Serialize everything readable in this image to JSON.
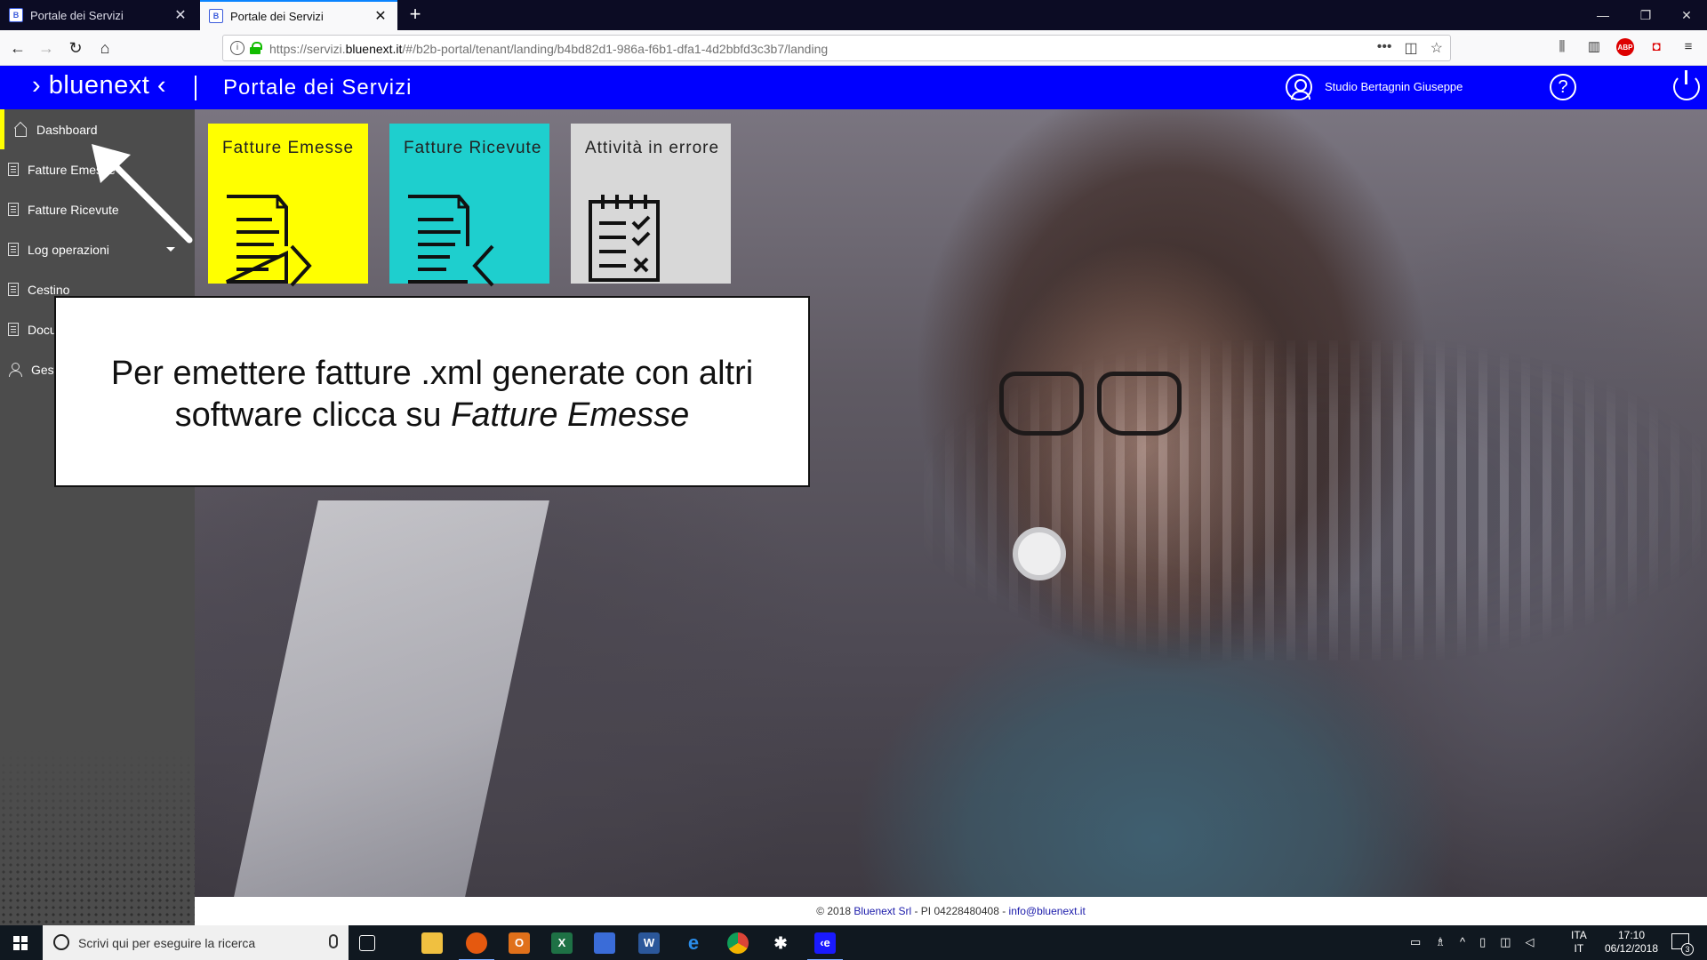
{
  "browser": {
    "tabs": [
      {
        "title": "Portale dei Servizi",
        "active": false
      },
      {
        "title": "Portale dei Servizi",
        "active": true
      }
    ],
    "url_prefix": "https://servizi.",
    "url_domain": "bluenext.it",
    "url_rest": "/#/b2b-portal/tenant/landing/b4bd82d1-986a-f6b1-dfa1-4d2bbfd3c3b7/landing",
    "url_actions_more": "•••"
  },
  "app": {
    "logo": "› bluenext ‹",
    "title": "Portale dei Servizi",
    "user": "Studio Bertagnin Giuseppe",
    "help_label": "?"
  },
  "sidebar": {
    "items": [
      {
        "label": "Dashboard",
        "icon": "home-icon"
      },
      {
        "label": "Fatture Emesse",
        "icon": "document-icon"
      },
      {
        "label": "Fatture Ricevute",
        "icon": "document-icon"
      },
      {
        "label": "Log operazioni",
        "icon": "log-icon"
      },
      {
        "label": "Cestino",
        "icon": "trash-document-icon"
      },
      {
        "label": "Documenti",
        "icon": "documents-icon"
      },
      {
        "label": "Gestione",
        "icon": "user-icon"
      }
    ]
  },
  "tiles": [
    {
      "title": "Fatture Emesse",
      "color": "#ffff00"
    },
    {
      "title": "Fatture Ricevute",
      "color": "#1ecfce"
    },
    {
      "title": "Attività in errore",
      "color": "#d8d8d8"
    }
  ],
  "callout": {
    "line1": "Per emettere fatture .xml generate con altri",
    "line2_plain": "software clicca su ",
    "line2_italic": "Fatture Emesse"
  },
  "footer": {
    "prefix": "© 2018 ",
    "company": "Bluenext Srl",
    "middle": " - PI 04228480408 - ",
    "email": "info@bluenext.it"
  },
  "taskbar": {
    "search_placeholder": "Scrivi qui per eseguire la ricerca",
    "lang_line1": "ITA",
    "lang_line2": "IT",
    "time": "17:10",
    "date": "06/12/2018",
    "notification_count": "3"
  },
  "colors": {
    "header_blue": "#0000ff",
    "sidebar_gray": "#4c4c4c",
    "active_marker": "#ffff00"
  }
}
